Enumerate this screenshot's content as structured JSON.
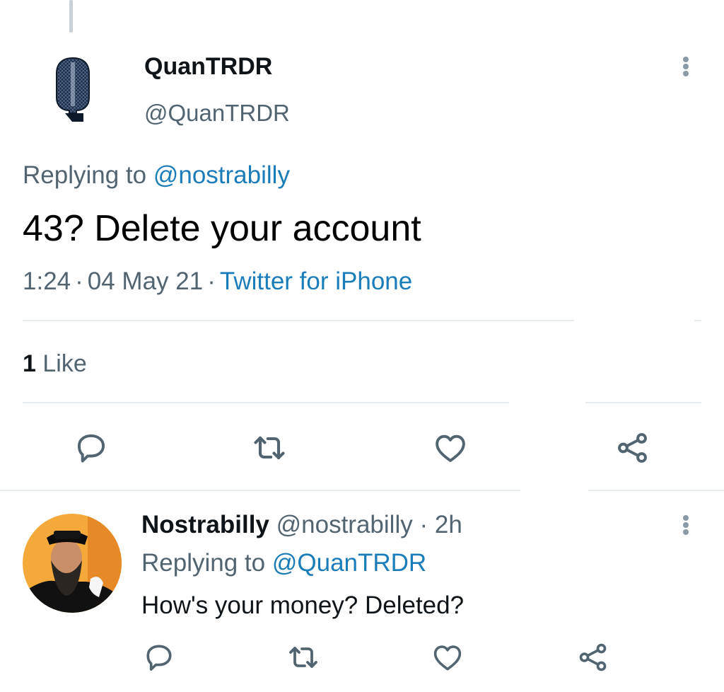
{
  "tweet": {
    "display_name": "QuanTRDR",
    "handle": "@QuanTRDR",
    "replying_prefix": "Replying to",
    "replying_to": "@nostrabilly",
    "text": "43? Delete your account",
    "time": "1:24",
    "date": "04 May 21",
    "source": "Twitter for iPhone",
    "separator": "·",
    "like_count": "1",
    "like_label": "Like"
  },
  "reply": {
    "display_name": "Nostrabilly",
    "handle": "@nostrabilly",
    "age": "2h",
    "replying_prefix": "Replying to",
    "replying_to": "@QuanTRDR",
    "text": "How's your money? Deleted?"
  },
  "icons": {
    "reply": "reply-icon",
    "retweet": "retweet-icon",
    "like": "heart-icon",
    "share": "share-icon",
    "more": "more-options-icon"
  },
  "colors": {
    "link": "#1a7dba",
    "secondary_text": "#536471",
    "icon": "#536471",
    "divider": "#e6ecf0"
  }
}
